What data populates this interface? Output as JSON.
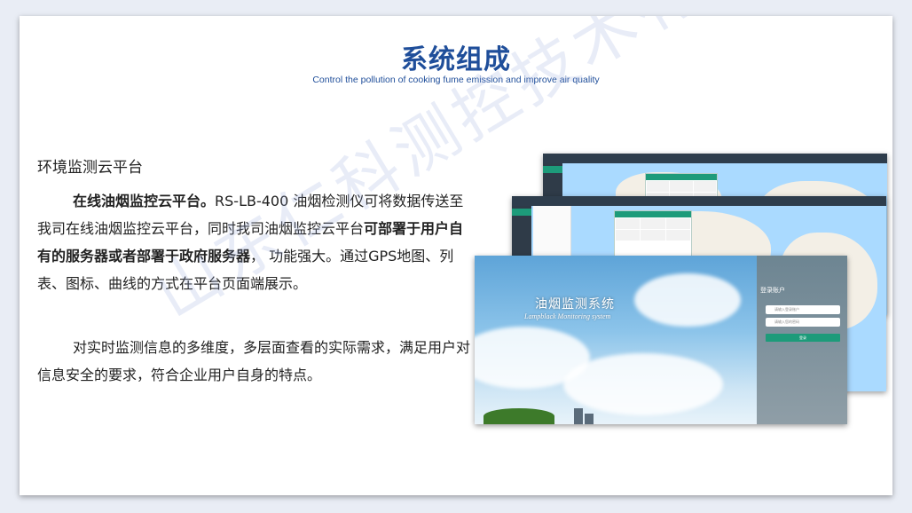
{
  "title": "系统组成",
  "subtitle": "Control the pollution of cooking fume emission and improve air quality",
  "section_heading": "环境监测云平台",
  "paragraph1": {
    "bold1": "在线油烟监控云平台。",
    "text1": "RS-LB-400 油烟检测仪可将数据传送至我司在线油烟监控云平台，同时我司油烟监控云平台",
    "bold2": "可部署于用户自有的服务器或者部署于政府服务器",
    "text2": "， 功能强大。通过GPS地图、列表、图标、曲线的方式在平台页面端展示。"
  },
  "paragraph2": "对实时监测信息的多维度，多层面查看的实际需求，满足用户对信息安全的要求，符合企业用户自身的特点。",
  "screenshot": {
    "app_title": "油烟监测系统",
    "app_subtitle": "Lampblack Monitoring system",
    "login_title": "登录账户",
    "username_placeholder": "请输入登录账户",
    "password_placeholder": "请输入您的密码",
    "login_button": "登录"
  },
  "watermark": "山东仁科测控技术有限公司",
  "colors": {
    "title": "#1f4e9a",
    "accent_green": "#1d9b7a",
    "sidebar_dark": "#2e3d4c"
  }
}
